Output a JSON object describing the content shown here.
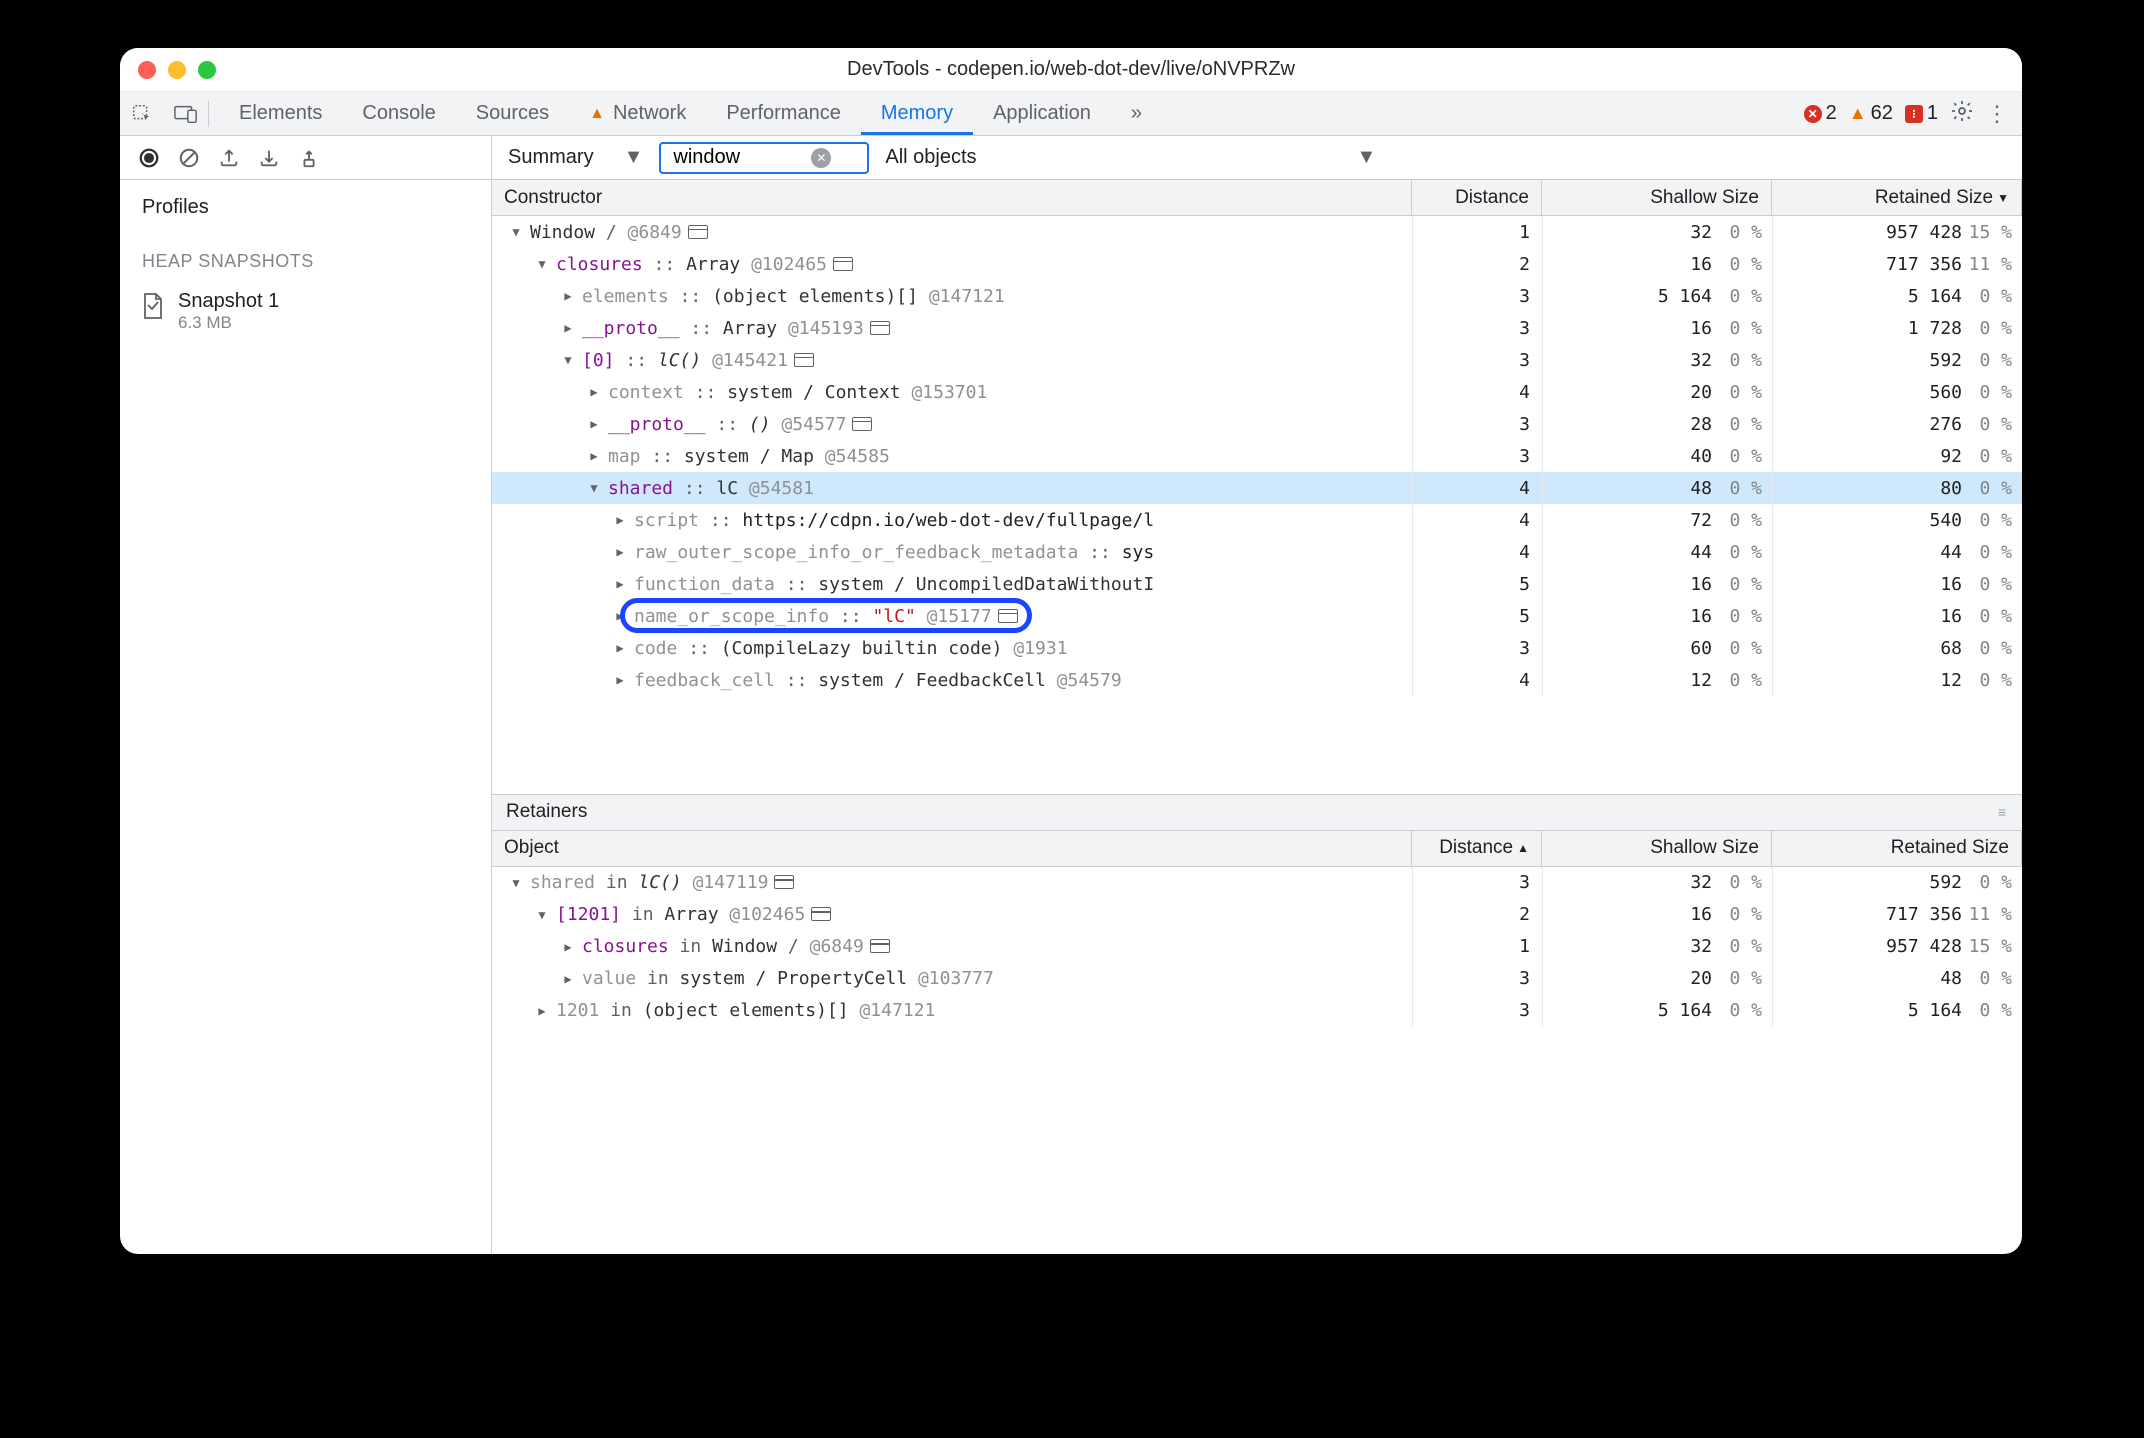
{
  "window": {
    "title": "DevTools - codepen.io/web-dot-dev/live/oNVPRZw"
  },
  "tabs": [
    "Elements",
    "Console",
    "Sources",
    "Network",
    "Performance",
    "Memory",
    "Application"
  ],
  "active_tab": "Memory",
  "network_warning_tab": "Network",
  "more_tabs": "»",
  "status": {
    "errors": 2,
    "warnings": 62,
    "extensions": 1
  },
  "toolbar": {
    "view": "Summary",
    "filter": "window",
    "scope": "All objects"
  },
  "sidebar": {
    "title": "Profiles",
    "section": "HEAP SNAPSHOTS",
    "snapshot": {
      "name": "Snapshot 1",
      "size": "6.3 MB"
    }
  },
  "columns": {
    "constructor": "Constructor",
    "distance": "Distance",
    "shallow": "Shallow Size",
    "retained": "Retained Size"
  },
  "rows": [
    {
      "indent": 0,
      "open": true,
      "disclosure": "down",
      "main": [
        {
          "t": "objref",
          "v": "Window"
        },
        {
          "t": "kw",
          "v": " /   "
        },
        {
          "t": "idref",
          "v": "@6849"
        },
        {
          "t": "winbox"
        }
      ],
      "dist": "1",
      "sv": "32",
      "sp": "0 %",
      "rv": "957 428",
      "rp": "15 %"
    },
    {
      "indent": 1,
      "open": true,
      "disclosure": "down",
      "main": [
        {
          "t": "prop",
          "v": "closures"
        },
        {
          "t": "sep-sym",
          "v": " :: "
        },
        {
          "t": "objref",
          "v": "Array"
        },
        {
          "t": "plain",
          "v": " "
        },
        {
          "t": "idref",
          "v": "@102465"
        },
        {
          "t": "winbox"
        }
      ],
      "dist": "2",
      "sv": "16",
      "sp": "0 %",
      "rv": "717 356",
      "rp": "11 %"
    },
    {
      "indent": 2,
      "disclosure": "right",
      "main": [
        {
          "t": "prop-grey",
          "v": "elements"
        },
        {
          "t": "sep-sym",
          "v": " :: "
        },
        {
          "t": "objref",
          "v": "(object elements)[]"
        },
        {
          "t": "plain",
          "v": " "
        },
        {
          "t": "idref",
          "v": "@147121"
        }
      ],
      "dist": "3",
      "sv": "5 164",
      "sp": "0 %",
      "rv": "5 164",
      "rp": "0 %"
    },
    {
      "indent": 2,
      "disclosure": "right",
      "main": [
        {
          "t": "prop",
          "v": "__proto__"
        },
        {
          "t": "sep-sym",
          "v": " :: "
        },
        {
          "t": "objref",
          "v": "Array"
        },
        {
          "t": "plain",
          "v": " "
        },
        {
          "t": "idref",
          "v": "@145193"
        },
        {
          "t": "winbox"
        }
      ],
      "dist": "3",
      "sv": "16",
      "sp": "0 %",
      "rv": "1 728",
      "rp": "0 %"
    },
    {
      "indent": 2,
      "open": true,
      "disclosure": "down",
      "main": [
        {
          "t": "prop",
          "v": "[0]"
        },
        {
          "t": "sep-sym",
          "v": " :: "
        },
        {
          "t": "objref-ital",
          "v": "lC()"
        },
        {
          "t": "plain",
          "v": " "
        },
        {
          "t": "idref",
          "v": "@145421"
        },
        {
          "t": "winbox"
        }
      ],
      "dist": "3",
      "sv": "32",
      "sp": "0 %",
      "rv": "592",
      "rp": "0 %"
    },
    {
      "indent": 3,
      "disclosure": "right",
      "main": [
        {
          "t": "prop-grey",
          "v": "context"
        },
        {
          "t": "sep-sym",
          "v": " :: "
        },
        {
          "t": "objref",
          "v": "system / Context"
        },
        {
          "t": "plain",
          "v": " "
        },
        {
          "t": "idref",
          "v": "@153701"
        }
      ],
      "dist": "4",
      "sv": "20",
      "sp": "0 %",
      "rv": "560",
      "rp": "0 %"
    },
    {
      "indent": 3,
      "disclosure": "right",
      "main": [
        {
          "t": "prop",
          "v": "__proto__"
        },
        {
          "t": "sep-sym",
          "v": " :: "
        },
        {
          "t": "objref-ital",
          "v": "()"
        },
        {
          "t": "plain",
          "v": " "
        },
        {
          "t": "idref",
          "v": "@54577"
        },
        {
          "t": "winbox"
        }
      ],
      "dist": "3",
      "sv": "28",
      "sp": "0 %",
      "rv": "276",
      "rp": "0 %"
    },
    {
      "indent": 3,
      "disclosure": "right",
      "main": [
        {
          "t": "prop-grey",
          "v": "map"
        },
        {
          "t": "sep-sym",
          "v": " :: "
        },
        {
          "t": "objref",
          "v": "system / Map"
        },
        {
          "t": "plain",
          "v": " "
        },
        {
          "t": "idref",
          "v": "@54585"
        }
      ],
      "dist": "3",
      "sv": "40",
      "sp": "0 %",
      "rv": "92",
      "rp": "0 %"
    },
    {
      "indent": 3,
      "open": true,
      "disclosure": "down",
      "selected": true,
      "main": [
        {
          "t": "prop",
          "v": "shared"
        },
        {
          "t": "sep-sym",
          "v": " :: "
        },
        {
          "t": "objref",
          "v": "lC"
        },
        {
          "t": "plain",
          "v": " "
        },
        {
          "t": "idref",
          "v": "@54581"
        }
      ],
      "dist": "4",
      "sv": "48",
      "sp": "0 %",
      "rv": "80",
      "rp": "0 %"
    },
    {
      "indent": 4,
      "disclosure": "right",
      "main": [
        {
          "t": "prop-grey",
          "v": "script"
        },
        {
          "t": "sep-sym",
          "v": " :: "
        },
        {
          "t": "plain",
          "v": "https://cdpn.io/web-dot-dev/fullpage/l"
        }
      ],
      "dist": "4",
      "sv": "72",
      "sp": "0 %",
      "rv": "540",
      "rp": "0 %"
    },
    {
      "indent": 4,
      "disclosure": "right",
      "main": [
        {
          "t": "prop-grey",
          "v": "raw_outer_scope_info_or_feedback_metadata"
        },
        {
          "t": "sep-sym",
          "v": " :: "
        },
        {
          "t": "plain",
          "v": "sys"
        }
      ],
      "dist": "4",
      "sv": "44",
      "sp": "0 %",
      "rv": "44",
      "rp": "0 %"
    },
    {
      "indent": 4,
      "disclosure": "right",
      "main": [
        {
          "t": "prop-grey",
          "v": "function_data"
        },
        {
          "t": "sep-sym",
          "v": " :: "
        },
        {
          "t": "objref",
          "v": "system / UncompiledDataWithoutI"
        }
      ],
      "dist": "5",
      "sv": "16",
      "sp": "0 %",
      "rv": "16",
      "rp": "0 %"
    },
    {
      "indent": 4,
      "disclosure": "right",
      "focusring": true,
      "main": [
        {
          "t": "prop-grey",
          "v": "name_or_scope_info"
        },
        {
          "t": "sep-sym",
          "v": " :: "
        },
        {
          "t": "string",
          "v": "\"lC\""
        },
        {
          "t": "plain",
          "v": " "
        },
        {
          "t": "idref",
          "v": "@15177"
        },
        {
          "t": "winbox"
        }
      ],
      "dist": "5",
      "sv": "16",
      "sp": "0 %",
      "rv": "16",
      "rp": "0 %"
    },
    {
      "indent": 4,
      "disclosure": "right",
      "main": [
        {
          "t": "prop-grey",
          "v": "code"
        },
        {
          "t": "sep-sym",
          "v": " :: "
        },
        {
          "t": "objref",
          "v": "(CompileLazy builtin code)"
        },
        {
          "t": "plain",
          "v": " "
        },
        {
          "t": "idref",
          "v": "@1931"
        }
      ],
      "dist": "3",
      "sv": "60",
      "sp": "0 %",
      "rv": "68",
      "rp": "0 %"
    },
    {
      "indent": 4,
      "disclosure": "right",
      "main": [
        {
          "t": "prop-grey",
          "v": "feedback_cell"
        },
        {
          "t": "sep-sym",
          "v": " :: "
        },
        {
          "t": "objref",
          "v": "system / FeedbackCell"
        },
        {
          "t": "plain",
          "v": " "
        },
        {
          "t": "idref",
          "v": "@54579"
        }
      ],
      "dist": "4",
      "sv": "12",
      "sp": "0 %",
      "rv": "12",
      "rp": "0 %"
    }
  ],
  "retainers": {
    "title": "Retainers",
    "columns": {
      "object": "Object",
      "distance": "Distance",
      "shallow": "Shallow Size",
      "retained": "Retained Size"
    },
    "rows": [
      {
        "indent": 0,
        "disclosure": "down",
        "main": [
          {
            "t": "prop-grey",
            "v": "shared"
          },
          {
            "t": "kw",
            "v": " in "
          },
          {
            "t": "objref-ital",
            "v": "lC()"
          },
          {
            "t": "plain",
            "v": " "
          },
          {
            "t": "idref",
            "v": "@147119"
          },
          {
            "t": "winbox"
          }
        ],
        "dist": "3",
        "sv": "32",
        "sp": "0 %",
        "rv": "592",
        "rp": "0 %"
      },
      {
        "indent": 1,
        "disclosure": "down",
        "main": [
          {
            "t": "prop",
            "v": "[1201]"
          },
          {
            "t": "kw",
            "v": " in "
          },
          {
            "t": "objref",
            "v": "Array"
          },
          {
            "t": "plain",
            "v": " "
          },
          {
            "t": "idref",
            "v": "@102465"
          },
          {
            "t": "winbox"
          }
        ],
        "dist": "2",
        "sv": "16",
        "sp": "0 %",
        "rv": "717 356",
        "rp": "11 %"
      },
      {
        "indent": 2,
        "disclosure": "right",
        "main": [
          {
            "t": "prop",
            "v": "closures"
          },
          {
            "t": "kw",
            "v": " in "
          },
          {
            "t": "objref",
            "v": "Window"
          },
          {
            "t": "kw",
            "v": " /   "
          },
          {
            "t": "idref",
            "v": "@6849"
          },
          {
            "t": "winbox"
          }
        ],
        "dist": "1",
        "sv": "32",
        "sp": "0 %",
        "rv": "957 428",
        "rp": "15 %"
      },
      {
        "indent": 2,
        "disclosure": "right",
        "main": [
          {
            "t": "prop-grey",
            "v": "value"
          },
          {
            "t": "kw",
            "v": " in "
          },
          {
            "t": "objref",
            "v": "system / PropertyCell"
          },
          {
            "t": "plain",
            "v": " "
          },
          {
            "t": "idref",
            "v": "@103777"
          }
        ],
        "dist": "3",
        "sv": "20",
        "sp": "0 %",
        "rv": "48",
        "rp": "0 %"
      },
      {
        "indent": 1,
        "disclosure": "right",
        "main": [
          {
            "t": "prop-grey",
            "v": "1201"
          },
          {
            "t": "kw",
            "v": " in "
          },
          {
            "t": "objref",
            "v": "(object elements)[]"
          },
          {
            "t": "plain",
            "v": " "
          },
          {
            "t": "idref",
            "v": "@147121"
          }
        ],
        "dist": "3",
        "sv": "5 164",
        "sp": "0 %",
        "rv": "5 164",
        "rp": "0 %"
      }
    ]
  }
}
